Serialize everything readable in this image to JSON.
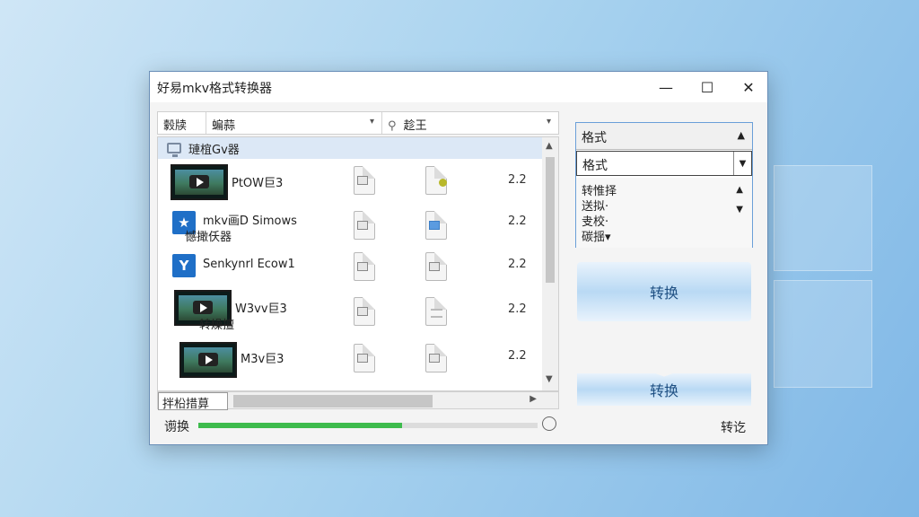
{
  "window": {
    "title": "好易mkv格式转换器",
    "controls": {
      "minimize": "—",
      "maximize": "☐",
      "close": "✕"
    }
  },
  "filters": {
    "first": "豰牍",
    "second": "蝙蒜",
    "third": "趁王"
  },
  "file_list": {
    "header": "璉椬Gv器",
    "rows": [
      {
        "name": "PtOW巨3",
        "num": "2.2",
        "has_thumb": true
      },
      {
        "name": "mkv画D Simows",
        "sub": "憾撖仸器",
        "num": "2.2",
        "has_thumb": false,
        "icon_letter": "★"
      },
      {
        "name": "Senkynrl Ecow1",
        "num": "2.2",
        "has_thumb": false,
        "icon_letter": "Y"
      },
      {
        "name": "W3vv巨3",
        "sub": "转燥擅",
        "num": "2.2",
        "has_thumb": true
      },
      {
        "name": "M3v巨3",
        "num": "2.2",
        "has_thumb": true
      }
    ]
  },
  "bottom_bar": {
    "tab_label": "拌柗措萛"
  },
  "progress": {
    "label": "谫换",
    "fraction": 0.6
  },
  "format_panel": {
    "header": "格式",
    "selected": "格式",
    "options": [
      "转惟择",
      "送拟·",
      "叏校·",
      "碳揺▾"
    ]
  },
  "buttons": {
    "convert_big": "转换",
    "convert_small": "转换"
  },
  "corner_label": "转讫"
}
